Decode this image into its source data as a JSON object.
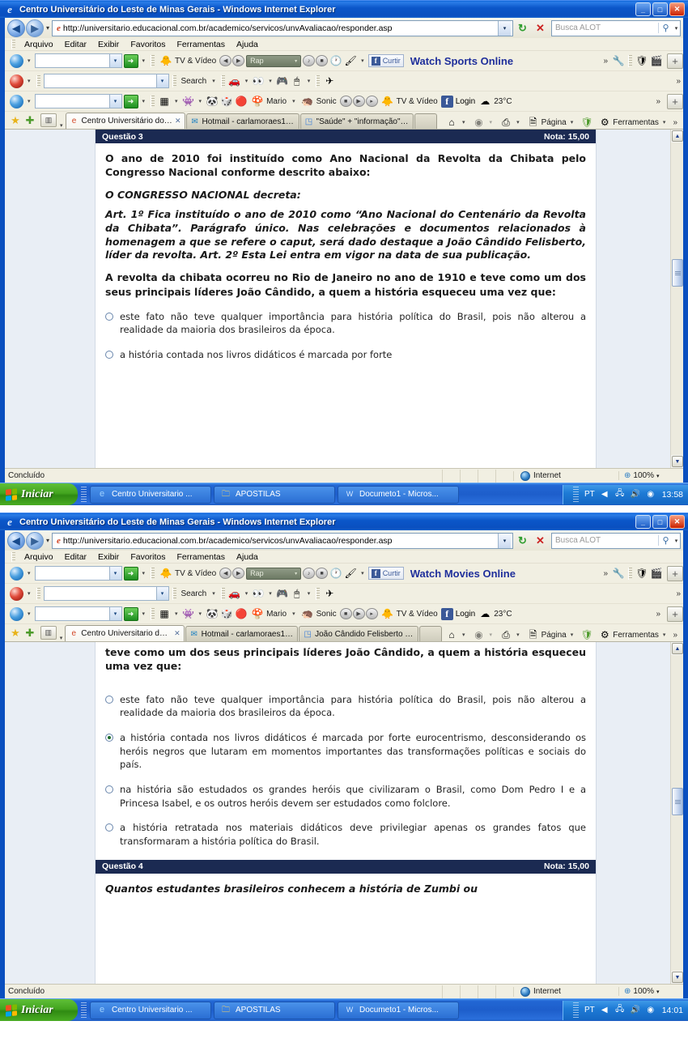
{
  "window": {
    "title": "Centro Universitário do Leste de Minas Gerais - Windows Internet Explorer",
    "minimize_label": "_",
    "maximize_label": "□",
    "close_label": "✕"
  },
  "address": {
    "url": "http://universitario.educacional.com.br/academico/servicos/unvAvaliacao/responder.asp",
    "back_label": "◀",
    "forward_label": "▶",
    "refresh_label": "↻",
    "stop_label": "✕",
    "dropdown_label": "▾"
  },
  "search": {
    "placeholder": "Busca ALOT",
    "magnifier": "⚲",
    "dropdown": "▾"
  },
  "menu": {
    "items": [
      "Arquivo",
      "Editar",
      "Exibir",
      "Favoritos",
      "Ferramentas",
      "Ajuda"
    ]
  },
  "toolbars": {
    "row1": {
      "input_value": "",
      "go_label": "➜",
      "tv_video_label": "TV & Vídeo",
      "genre_label": "Rap",
      "curtir_label": "Curtir",
      "fb_mark": "f",
      "promo_text_window1": "Watch Sports Online",
      "promo_text_window2": "Watch Movies Online",
      "chevron": "»",
      "plus_label": "+"
    },
    "row2": {
      "input_value": "",
      "search_label": "Search",
      "dropdown": "▾"
    },
    "row3": {
      "input_value": "",
      "go_label": "➜",
      "mario_label": "Mario",
      "sonic_label": "Sonic",
      "tv_video_label": "TV & Vídeo",
      "login_label": "Login",
      "temperature": "23°C",
      "chevron": "»",
      "plus_label": "+"
    }
  },
  "tabs": {
    "favorites_star": "★",
    "add_favorite": "✚",
    "quick_tabs": "▥",
    "window1": [
      {
        "label": "Centro Universitário do L...",
        "icon": "e",
        "active": true,
        "close": "✕"
      },
      {
        "label": "Hotmail - carlamoraes18@h...",
        "icon": "✉",
        "active": false
      },
      {
        "label": "\"Saúde\" + \"informação\" - Pe...",
        "icon": "◳",
        "active": false
      }
    ],
    "window2": [
      {
        "label": "Centro Universitario do L...",
        "icon": "e",
        "active": true,
        "close": "✕"
      },
      {
        "label": "Hotmail - carlamoraes18@h...",
        "icon": "✉",
        "active": false
      },
      {
        "label": "João Cândido Felisberto - P...",
        "icon": "◳",
        "active": false
      }
    ],
    "right_tools": {
      "home": "⌂",
      "feeds": "◉",
      "print": "⎙",
      "page_label": "Página",
      "tools_label": "Ferramentas",
      "chevron": "»",
      "dropdown": "▾"
    }
  },
  "question3": {
    "header_label": "Questão 3",
    "nota_label": "Nota: 15,00",
    "intro": "O ano de 2010 foi instituído como Ano Nacional da Revolta da Chibata pelo Congresso Nacional conforme descrito abaixo:",
    "decreta": "O CONGRESSO NACIONAL decreta:",
    "artigos": "Art. 1º Fica instituído o ano de 2010 como “Ano Nacional do Centenário da Revolta da Chibata”. Parágrafo único. Nas celebrações e documentos relacionados à homenagem a que se refere o caput, será dado destaque a João Cândido Felisberto, líder da revolta. Art. 2º Esta Lei entra em vigor na data de sua publicação.",
    "enunciado": "A revolta da chibata ocorreu no Rio de Janeiro no ano de 1910 e teve como um dos seus principais líderes João Cândido, a quem a história esqueceu uma vez que:",
    "enunciado_partial": "teve como um dos seus principais líderes João Cândido, a quem a história esqueceu uma vez que:",
    "options": [
      {
        "text": "este fato não teve qualquer importância para história política do Brasil, pois não alterou a realidade da maioria dos brasileiros da época.",
        "selected": false
      },
      {
        "text": "a história contada nos livros didáticos é marcada por forte eurocentrismo, desconsiderando os heróis negros que lutaram em momentos importantes das transformações políticas e sociais do país.",
        "selected": true
      },
      {
        "text": "na história são estudados os grandes heróis que civilizaram o Brasil, como Dom Pedro I e a Princesa Isabel, e os outros heróis devem ser estudados como folclore.",
        "selected": false
      },
      {
        "text": "a história retratada nos materiais didáticos deve privilegiar apenas os grandes fatos que transformaram a história política do Brasil.",
        "selected": false
      }
    ],
    "option_partial": "a história contada nos livros didáticos é marcada por forte"
  },
  "question4": {
    "header_label": "Questão 4",
    "nota_label": "Nota: 15,00",
    "intro": "Quantos estudantes brasileiros conhecem a história de Zumbi ou"
  },
  "statusbar": {
    "text": "Concluído",
    "zone": "Internet",
    "zoom": "100%",
    "zoom_dropdown": "▾",
    "zoom_icon": "⊕"
  },
  "taskbar": {
    "start_label": "Iniciar",
    "items": [
      {
        "label": "Centro Universitario ...",
        "icon": "e"
      },
      {
        "label": "APOSTILAS",
        "icon": "📁"
      },
      {
        "label": "Documeto1 - Micros...",
        "icon": "W"
      }
    ],
    "tray": {
      "language": "PT",
      "clock_window1": "13:58",
      "clock_window2": "14:01"
    }
  },
  "scrollbar": {
    "up_arrow": "▲",
    "down_arrow": "▼"
  },
  "colors": {
    "title_blue": "#0a4fbf",
    "question_header": "#1b2a52",
    "toolbar_beige": "#f1efe2",
    "promo_blue": "#1f2f9b",
    "selected_radio": "#1d6b2a",
    "start_green": "#43a51f"
  }
}
